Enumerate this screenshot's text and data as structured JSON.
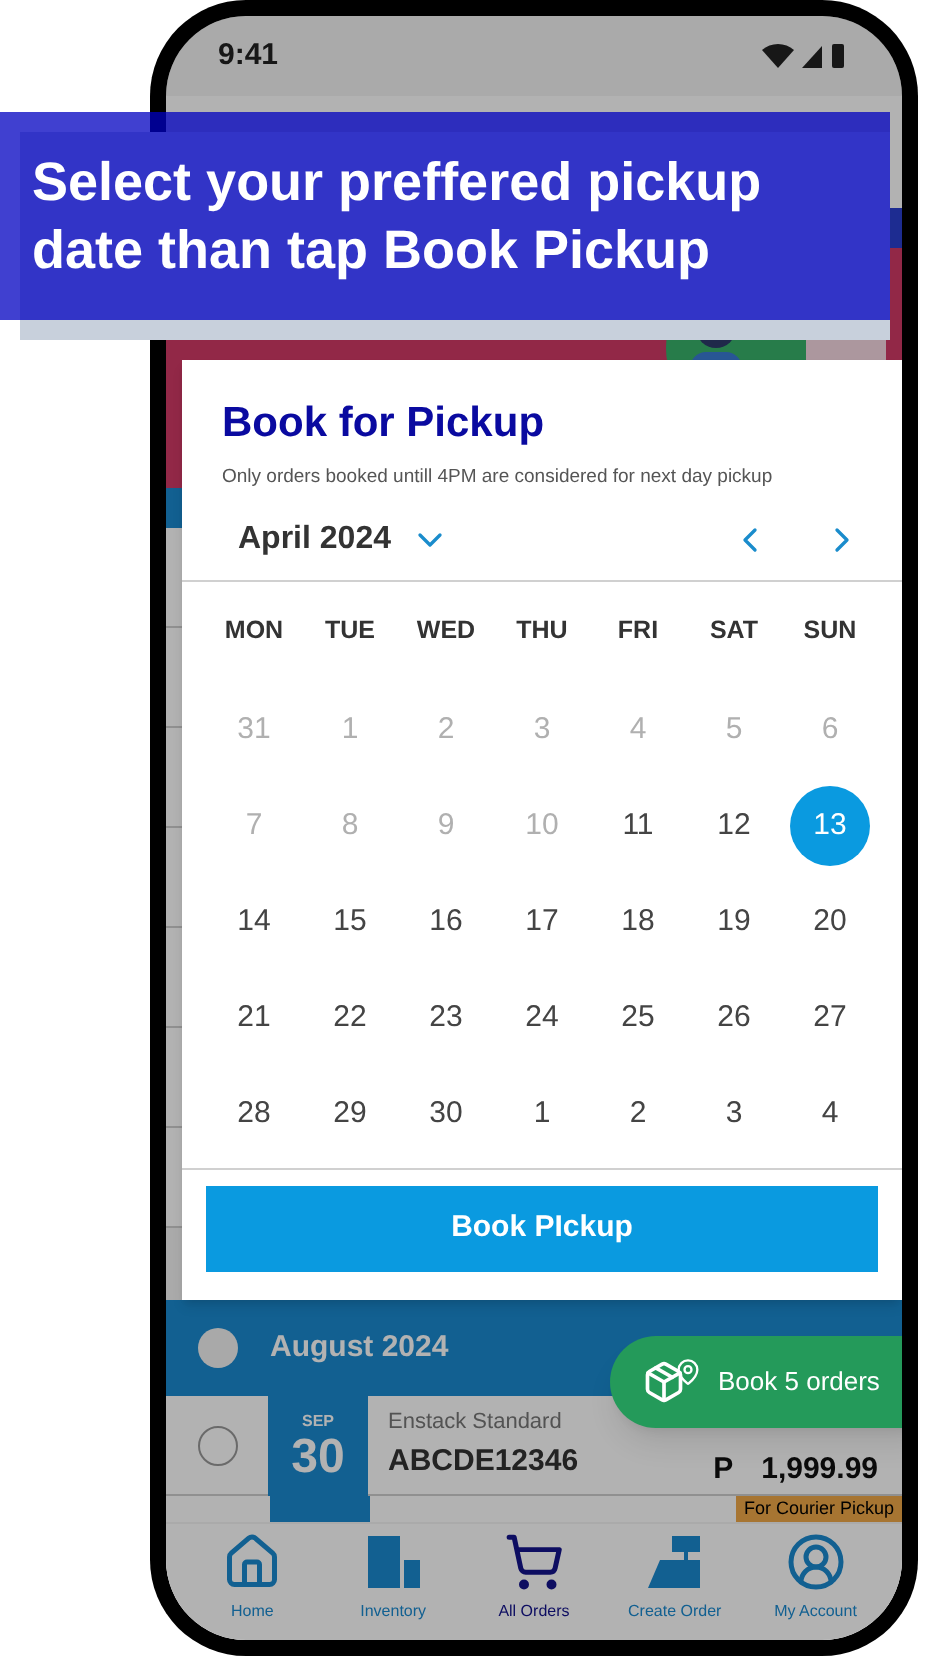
{
  "status_bar": {
    "time": "9:41"
  },
  "callout": {
    "text": "Select your preffered pickup date than tap Book Pickup"
  },
  "background_list": {
    "group_header": {
      "label": "August 2024",
      "checked": false
    },
    "order": {
      "month": "SEP",
      "day": "30",
      "service": "Enstack Standard",
      "tracking": "ABCDE12346",
      "currency": "P",
      "amount": "1,999.99",
      "checked": false
    },
    "tag": "For Courier Pickup"
  },
  "book_orders_button": {
    "label": "Book 5 orders"
  },
  "dialog": {
    "title": "Book for Pickup",
    "note": "Only orders booked untill 4PM are considered for next day pickup",
    "month": "April 2024",
    "weekdays": [
      "MON",
      "TUE",
      "WED",
      "THU",
      "FRI",
      "SAT",
      "SUN"
    ],
    "days": [
      {
        "label": "31",
        "muted": true,
        "selected": false
      },
      {
        "label": "1",
        "muted": true,
        "selected": false
      },
      {
        "label": "2",
        "muted": true,
        "selected": false
      },
      {
        "label": "3",
        "muted": true,
        "selected": false
      },
      {
        "label": "4",
        "muted": true,
        "selected": false
      },
      {
        "label": "5",
        "muted": true,
        "selected": false
      },
      {
        "label": "6",
        "muted": true,
        "selected": false
      },
      {
        "label": "7",
        "muted": true,
        "selected": false
      },
      {
        "label": "8",
        "muted": true,
        "selected": false
      },
      {
        "label": "9",
        "muted": true,
        "selected": false
      },
      {
        "label": "10",
        "muted": true,
        "selected": false
      },
      {
        "label": "11",
        "muted": false,
        "selected": false
      },
      {
        "label": "12",
        "muted": false,
        "selected": false
      },
      {
        "label": "13",
        "muted": false,
        "selected": true
      },
      {
        "label": "14",
        "muted": false,
        "selected": false
      },
      {
        "label": "15",
        "muted": false,
        "selected": false
      },
      {
        "label": "16",
        "muted": false,
        "selected": false
      },
      {
        "label": "17",
        "muted": false,
        "selected": false
      },
      {
        "label": "18",
        "muted": false,
        "selected": false
      },
      {
        "label": "19",
        "muted": false,
        "selected": false
      },
      {
        "label": "20",
        "muted": false,
        "selected": false
      },
      {
        "label": "21",
        "muted": false,
        "selected": false
      },
      {
        "label": "22",
        "muted": false,
        "selected": false
      },
      {
        "label": "23",
        "muted": false,
        "selected": false
      },
      {
        "label": "24",
        "muted": false,
        "selected": false
      },
      {
        "label": "25",
        "muted": false,
        "selected": false
      },
      {
        "label": "26",
        "muted": false,
        "selected": false
      },
      {
        "label": "27",
        "muted": false,
        "selected": false
      },
      {
        "label": "28",
        "muted": false,
        "selected": false
      },
      {
        "label": "29",
        "muted": false,
        "selected": false
      },
      {
        "label": "30",
        "muted": false,
        "selected": false
      },
      {
        "label": "1",
        "muted": false,
        "selected": false
      },
      {
        "label": "2",
        "muted": false,
        "selected": false
      },
      {
        "label": "3",
        "muted": false,
        "selected": false
      },
      {
        "label": "4",
        "muted": false,
        "selected": false
      }
    ],
    "button": "Book PIckup"
  },
  "bottom_nav": [
    {
      "label": "Home",
      "selected": false
    },
    {
      "label": "Inventory",
      "selected": false
    },
    {
      "label": "All Orders",
      "selected": true
    },
    {
      "label": "Create Order",
      "selected": false
    },
    {
      "label": "My Account",
      "selected": false
    }
  ]
}
